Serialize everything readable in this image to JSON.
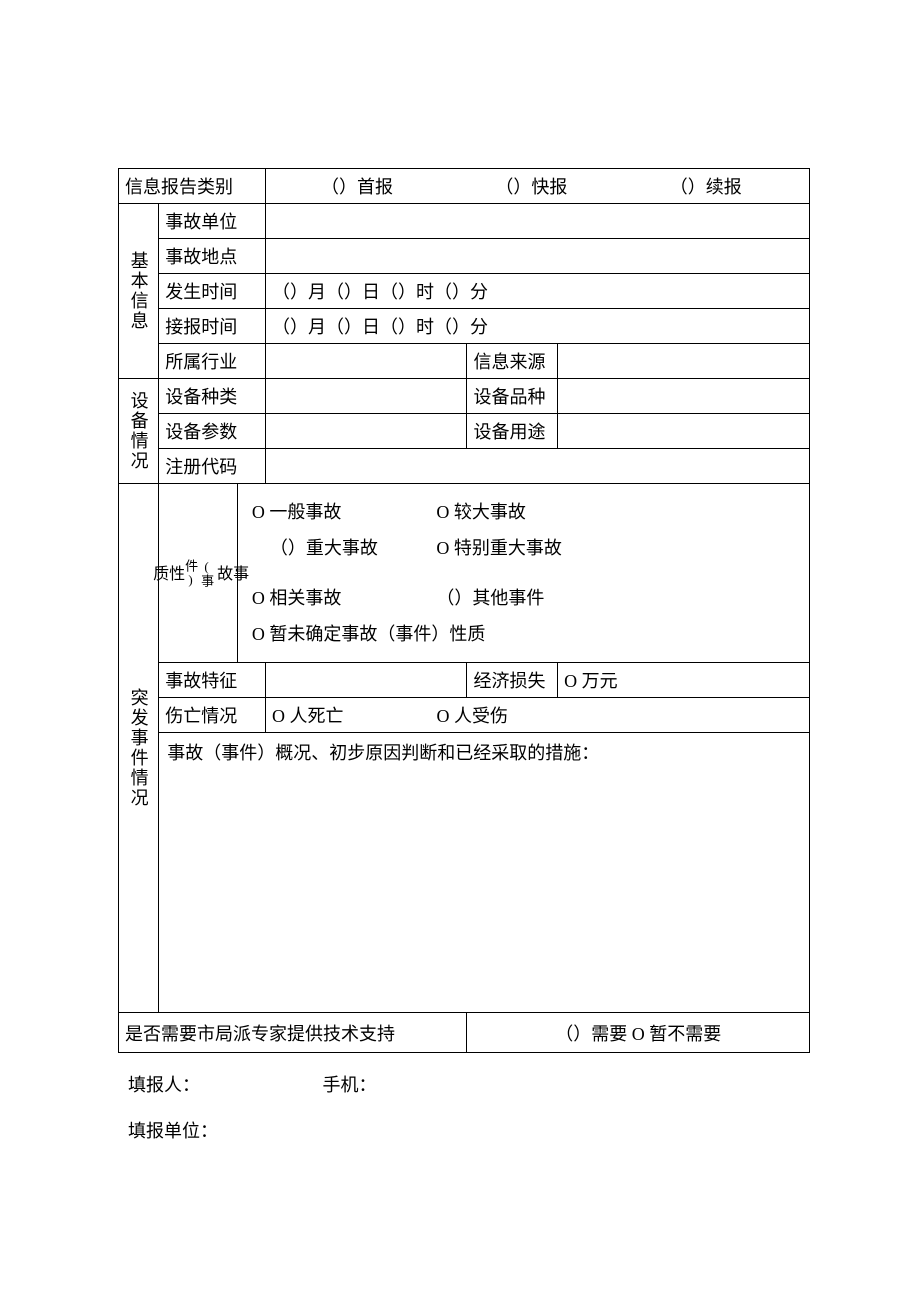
{
  "header": {
    "report_category_label": "信息报告类别",
    "opt_first": "（）首报",
    "opt_quick": "（）快报",
    "opt_follow": "（）续报"
  },
  "basic": {
    "section": "基本信息",
    "unit_label": "事故单位",
    "unit_value": "",
    "location_label": "事故地点",
    "location_value": "",
    "occur_time_label": "发生时间",
    "occur_time_value": "（）月（）日（）时（）分",
    "recv_time_label": "接报时间",
    "recv_time_value": "（）月（）日（）时（）分",
    "industry_label": "所属行业",
    "industry_value": "",
    "source_label": "信息来源",
    "source_value": ""
  },
  "equip": {
    "section": "设备情况",
    "type_label": "设备种类",
    "type_value": "",
    "variety_label": "设备品种",
    "variety_value": "",
    "param_label": "设备参数",
    "param_value": "",
    "usage_label": "设备用途",
    "usage_value": "",
    "reg_label": "注册代码",
    "reg_value": ""
  },
  "incident": {
    "section": "突发事件情况",
    "nature_section": "事故\n(事件)性质",
    "opt_general": "O 一般事故",
    "opt_large": "O 较大事故",
    "opt_major": "（）重大事故",
    "opt_extra": "O 特别重大事故",
    "opt_related": "O 相关事故",
    "opt_other": "（）其他事件",
    "opt_undetermined": "O 暂未确定事故（事件）性质",
    "feature_label": "事故特征",
    "feature_value": "",
    "loss_label": "经济损失",
    "loss_value": "O 万元",
    "casualty_label": "伤亡情况",
    "casualty_death": "O 人死亡",
    "casualty_injury": "O 人受伤",
    "desc_label": "事故（事件）概况、初步原因判断和已经采取的措施：",
    "desc_value": ""
  },
  "support": {
    "label": "是否需要市局派专家提供技术支持",
    "opt_need": "（）需要 O 暂不需要"
  },
  "footer": {
    "reporter_label": "填报人：",
    "phone_label": "手机：",
    "unit_label": "填报单位："
  }
}
